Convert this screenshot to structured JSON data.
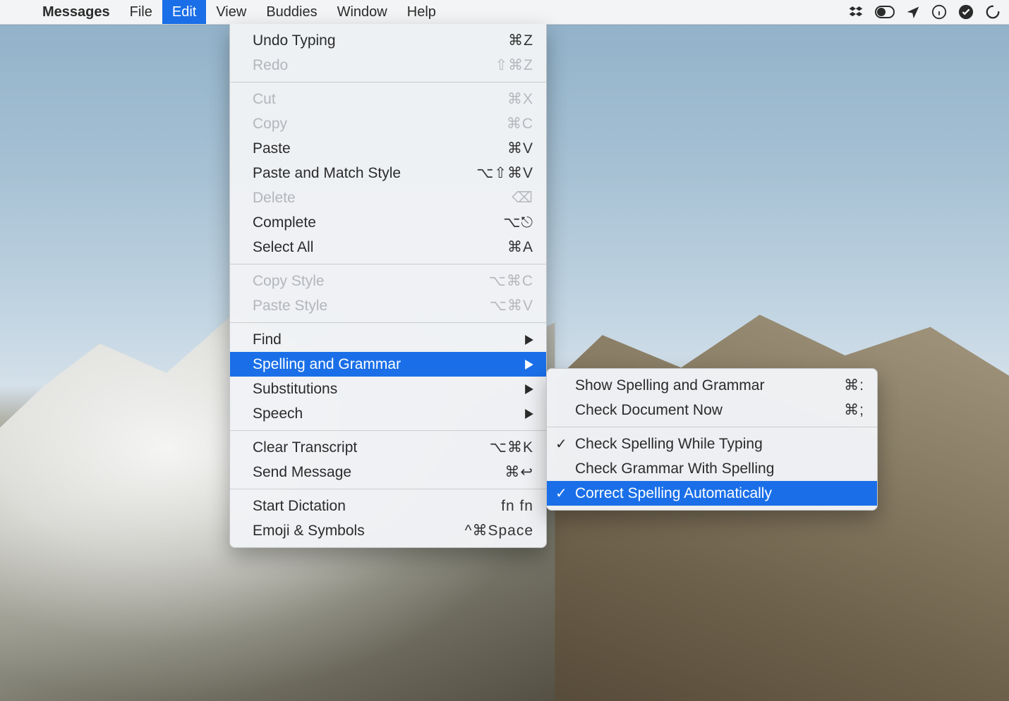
{
  "menubar": {
    "app_name": "Messages",
    "items": [
      {
        "label": "File"
      },
      {
        "label": "Edit",
        "active": true
      },
      {
        "label": "View"
      },
      {
        "label": "Buddies"
      },
      {
        "label": "Window"
      },
      {
        "label": "Help"
      }
    ],
    "status_icons": [
      "dropbox-icon",
      "switch-icon",
      "location-icon",
      "info-icon",
      "check-circle-icon",
      "spinner-icon"
    ]
  },
  "edit_menu": {
    "groups": [
      [
        {
          "label": "Undo Typing",
          "shortcut": "⌘Z"
        },
        {
          "label": "Redo",
          "shortcut": "⇧⌘Z",
          "disabled": true
        }
      ],
      [
        {
          "label": "Cut",
          "shortcut": "⌘X",
          "disabled": true
        },
        {
          "label": "Copy",
          "shortcut": "⌘C",
          "disabled": true
        },
        {
          "label": "Paste",
          "shortcut": "⌘V"
        },
        {
          "label": "Paste and Match Style",
          "shortcut": "⌥⇧⌘V"
        },
        {
          "label": "Delete",
          "shortcut": "⌫",
          "disabled": true
        },
        {
          "label": "Complete",
          "shortcut": "⌥⎋"
        },
        {
          "label": "Select All",
          "shortcut": "⌘A"
        }
      ],
      [
        {
          "label": "Copy Style",
          "shortcut": "⌥⌘C",
          "disabled": true
        },
        {
          "label": "Paste Style",
          "shortcut": "⌥⌘V",
          "disabled": true
        }
      ],
      [
        {
          "label": "Find",
          "submenu": true
        },
        {
          "label": "Spelling and Grammar",
          "submenu": true,
          "highlight": true
        },
        {
          "label": "Substitutions",
          "submenu": true
        },
        {
          "label": "Speech",
          "submenu": true
        }
      ],
      [
        {
          "label": "Clear Transcript",
          "shortcut": "⌥⌘K"
        },
        {
          "label": "Send Message",
          "shortcut": "⌘↩"
        }
      ],
      [
        {
          "label": "Start Dictation",
          "shortcut": "fn fn"
        },
        {
          "label": "Emoji & Symbols",
          "shortcut": "^⌘Space"
        }
      ]
    ]
  },
  "spelling_submenu": {
    "groups": [
      [
        {
          "label": "Show Spelling and Grammar",
          "shortcut": "⌘:"
        },
        {
          "label": "Check Document Now",
          "shortcut": "⌘;"
        }
      ],
      [
        {
          "label": "Check Spelling While Typing",
          "checked": true
        },
        {
          "label": "Check Grammar With Spelling"
        },
        {
          "label": "Correct Spelling Automatically",
          "checked": true,
          "highlight": true
        }
      ]
    ]
  }
}
